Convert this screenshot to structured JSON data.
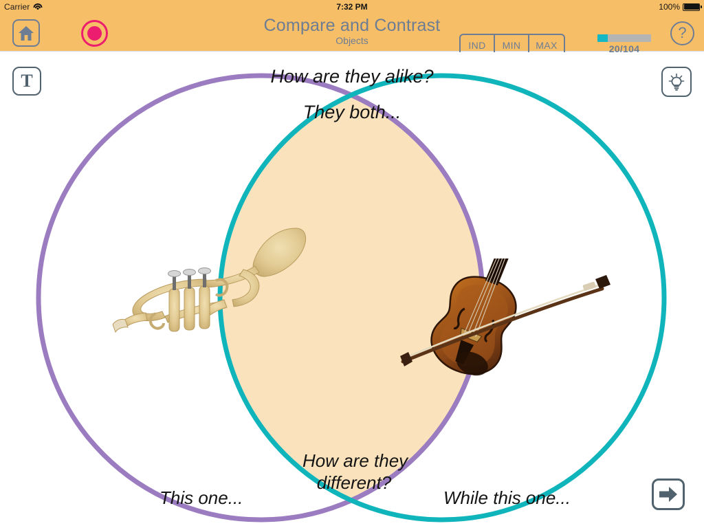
{
  "status_bar": {
    "carrier": "Carrier",
    "wifi_icon": "wifi-icon",
    "time": "7:32 PM",
    "battery_percent": "100%",
    "battery_icon": "battery-full-icon"
  },
  "nav_bar": {
    "home_icon": "home-icon",
    "record_icon": "record-icon",
    "title": "Compare and Contrast",
    "subtitle": "Objects",
    "segmented_control": {
      "options": [
        "IND",
        "MIN",
        "MAX"
      ],
      "selected": null
    },
    "progress": {
      "label": "20/104",
      "current": 20,
      "total": 104,
      "percent": 19,
      "fill_color": "#14B8C4",
      "track_color": "#B4B4B4"
    },
    "help_icon": "question-mark-icon",
    "help_label": "?",
    "background_color": "#F7BE68",
    "text_color": "#6C7D94"
  },
  "toolbar": {
    "text_button_label": "T",
    "text_button_icon": "text-tool-icon",
    "hint_button_icon": "lightbulb-icon",
    "next_button_icon": "arrow-right-icon"
  },
  "worksheet": {
    "prompt_alike": "How are they alike?",
    "prompt_both": "They both...",
    "prompt_different": "How are they\ndifferent?",
    "prompt_different_line1": "How are they",
    "prompt_different_line2": "different?",
    "prompt_left": "This one...",
    "prompt_right": "While this one...",
    "left_circle": {
      "color": "#9B7CC0",
      "item_icon": "trumpet-image",
      "item_label": "trumpet"
    },
    "right_circle": {
      "color": "#10B5BC",
      "item_icon": "violin-image",
      "item_label": "violin"
    },
    "intersection_fill": "#FAE3BC"
  }
}
